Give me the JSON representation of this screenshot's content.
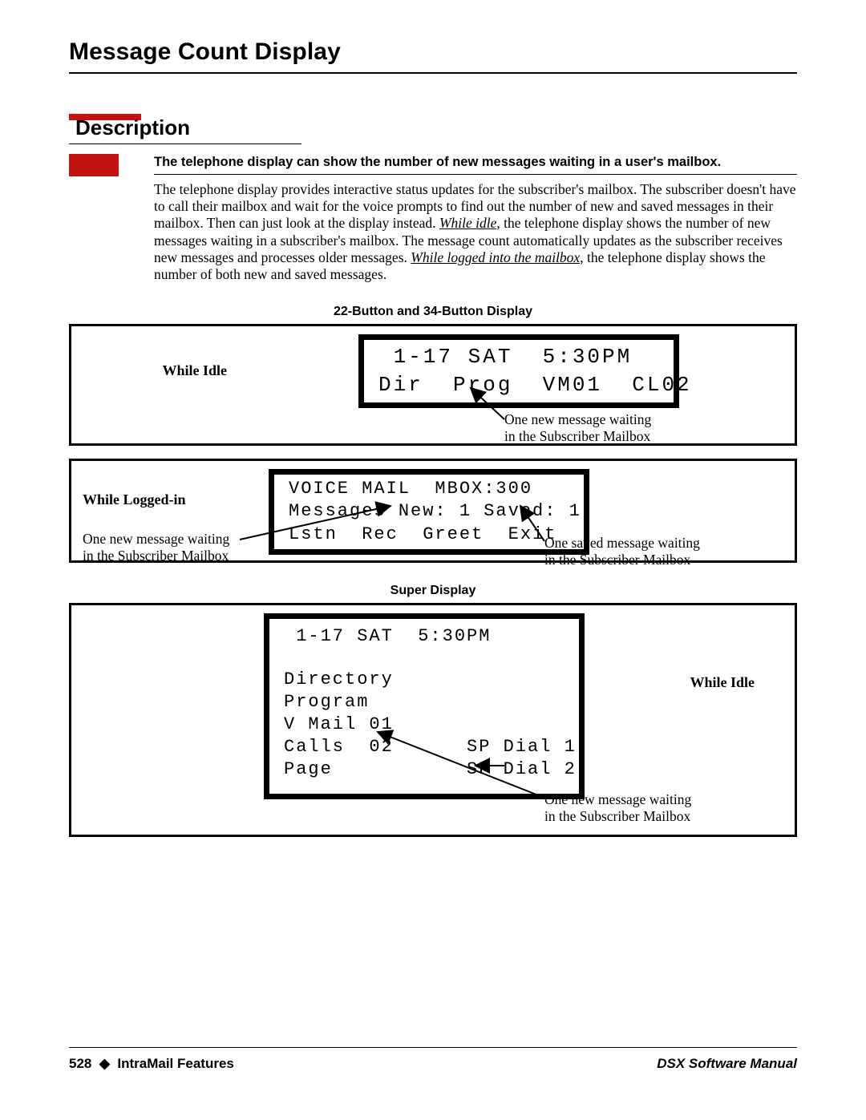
{
  "page": {
    "title": "Message Count Display",
    "section_heading": "Description",
    "summary": "The telephone display can show the number of new messages waiting in a user's mailbox.",
    "body_pre": "The telephone display provides interactive status updates for the subscriber's mailbox. The subscriber doesn't have to call their mailbox and wait for the voice prompts to find out the number of new and saved messages in their mailbox. Then can just look at the display instead. ",
    "body_link1": "While idle",
    "body_mid": ", the telephone display shows the number of new messages waiting in a subscriber's mailbox. The message count automatically updates as the subscriber receives new messages and processes older messages. ",
    "body_link2": "While logged into the mailbox",
    "body_post": ", the tele­phone display shows the number of both new and saved messages."
  },
  "diagram1": {
    "caption": "22-Button and 34-Button Display",
    "side_label": "While Idle",
    "lcd_line1": " 1-17 SAT  5:30PM",
    "lcd_line2": "Dir  Prog  VM01  CL02",
    "callout": "One new message waiting\nin the Subscriber Mailbox"
  },
  "diagram2": {
    "side_label": "While Logged-in",
    "lcd_line1": "VOICE MAIL  MBOX:300",
    "lcd_line2": "Messages New: 1 Saved: 1",
    "lcd_line3": "Lstn  Rec  Greet  Exit",
    "left_callout": "One new message waiting\nin the Subscriber Mailbox",
    "right_callout": "One saved message waiting\nin the Subscriber Mailbox"
  },
  "diagram3": {
    "caption": "Super Display",
    "side_label": "While Idle",
    "lcd_line1": " 1-17 SAT  5:30PM",
    "lcd_l2": "Directory",
    "lcd_l3": "Program",
    "lcd_l4": "V Mail 01         ",
    "lcd_l5": "Calls  02      SP Dial 1",
    "lcd_l6": "Page           SP Dial 2",
    "callout": "One new message waiting\nin the Subscriber Mailbox"
  },
  "footer": {
    "page_num": "528",
    "diamond": "◆",
    "section": "IntraMail Features",
    "manual": "DSX Software Manual"
  }
}
